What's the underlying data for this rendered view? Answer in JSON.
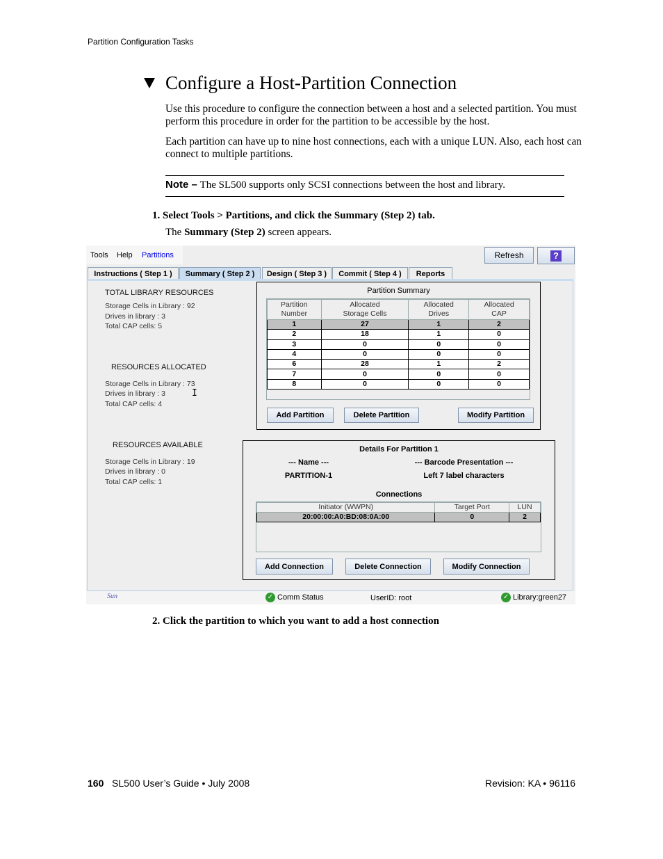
{
  "running_header": "Partition Configuration Tasks",
  "section": {
    "toggle_icon": "triangle-down-icon",
    "title": "Configure a Host-Partition Connection"
  },
  "paragraphs": [
    "Use this procedure to configure the connection between a host and a selected partition. You must perform this procedure in order for the partition to be accessible by the host.",
    "Each partition can have up to nine host connections, each with a unique LUN. Also, each host can connect to multiple partitions."
  ],
  "note": {
    "label": "Note –",
    "text": "The SL500 supports only SCSI connections between the host and library."
  },
  "steps": [
    {
      "num": "1.",
      "text": "Select Tools > Partitions, and click the Summary (Step 2) tab.",
      "result_pre": "The ",
      "result_bold": "Summary (Step 2)",
      "result_post": " screen appears."
    },
    {
      "num": "2.",
      "text": "Click the partition to which you want to add a host connection"
    }
  ],
  "app": {
    "menu": [
      "Tools",
      "Help",
      "Partitions"
    ],
    "refresh": "Refresh",
    "help_icon": "question-mark-icon",
    "help_glyph": "?",
    "tabs": [
      "Instructions ( Step 1 )",
      "Summary ( Step 2 )",
      "Design ( Step 3 )",
      "Commit ( Step 4 )",
      "Reports"
    ],
    "selected_tab": 1,
    "total": {
      "title": "TOTAL LIBRARY RESOURCES",
      "lines": [
        "Storage Cells in Library : 92",
        "Drives in library : 3",
        "Total CAP cells: 5"
      ]
    },
    "allocated": {
      "title": "RESOURCES ALLOCATED",
      "lines": [
        "Storage Cells in Library : 73",
        "Drives in library : 3",
        "Total CAP cells: 4"
      ]
    },
    "available": {
      "title": "RESOURCES AVAILABLE",
      "lines": [
        "Storage Cells in Library : 19",
        "Drives in library : 0",
        "Total CAP cells: 1"
      ]
    },
    "summary": {
      "title": "Partition Summary",
      "headers": [
        [
          "Partition",
          "Number"
        ],
        [
          "Allocated",
          "Storage Cells"
        ],
        [
          "Allocated",
          "Drives"
        ],
        [
          "Allocated",
          "CAP"
        ]
      ],
      "rows": [
        [
          "1",
          "27",
          "1",
          "2"
        ],
        [
          "2",
          "18",
          "1",
          "0"
        ],
        [
          "3",
          "0",
          "0",
          "0"
        ],
        [
          "4",
          "0",
          "0",
          "0"
        ],
        [
          "6",
          "28",
          "1",
          "2"
        ],
        [
          "7",
          "0",
          "0",
          "0"
        ],
        [
          "8",
          "0",
          "0",
          "0"
        ]
      ],
      "selected_row": 0,
      "buttons": [
        "Add Partition",
        "Delete Partition",
        "Modify Partition"
      ]
    },
    "details": {
      "title": "Details For Partition 1",
      "name_label": "--- Name ---",
      "name_value": "PARTITION-1",
      "barcode_label": "--- Barcode Presentation ---",
      "barcode_value": "Left 7 label characters",
      "connections_title": "Connections",
      "headers": [
        "Initiator (WWPN)",
        "Target Port",
        "LUN"
      ],
      "rows": [
        [
          "20:00:00:A0:BD:08:0A:00",
          "0",
          "2"
        ]
      ],
      "buttons": [
        "Add Connection",
        "Delete Connection",
        "Modify Connection"
      ]
    },
    "status": {
      "logo": "Sun",
      "comm": "Comm Status",
      "user": "UserID: root",
      "library": "Library:green27",
      "status_color": "#2f9b2f"
    }
  },
  "footer": {
    "page": "160",
    "left": "SL500 User’s Guide",
    "sep": "•",
    "date": "July 2008",
    "right": "Revision: KA",
    "doc": "96116"
  }
}
